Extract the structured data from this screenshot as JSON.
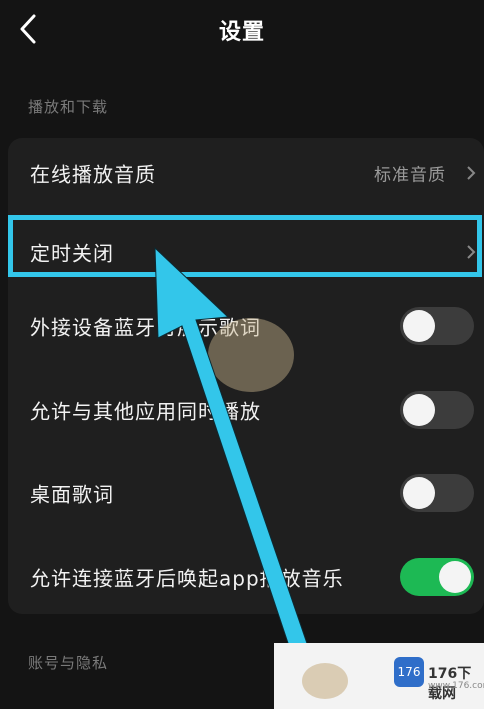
{
  "header": {
    "title": "设置",
    "back_icon": "chevron-left-icon"
  },
  "sections": {
    "playback_download": "播放和下载",
    "account_privacy": "账号与隐私"
  },
  "rows": [
    {
      "label": "在线播放音质",
      "value": "标准音质",
      "control": "chevron"
    },
    {
      "label": "定时关闭",
      "control": "chevron",
      "highlighted": true
    },
    {
      "label": "外接设备蓝牙时展示歌词",
      "control": "toggle",
      "state": "off"
    },
    {
      "label": "允许与其他应用同时播放",
      "control": "toggle",
      "state": "off"
    },
    {
      "label": "桌面歌词",
      "control": "toggle",
      "state": "off"
    },
    {
      "label": "允许连接蓝牙后唤起app播放音乐",
      "control": "toggle",
      "state": "on"
    }
  ],
  "watermark": {
    "logo": "176",
    "name": "176下载网",
    "url": "www.176.com"
  },
  "colors": {
    "accent_green": "#1db954",
    "highlight": "#33c6ea",
    "background": "#141414",
    "card": "#1f1f1f"
  }
}
